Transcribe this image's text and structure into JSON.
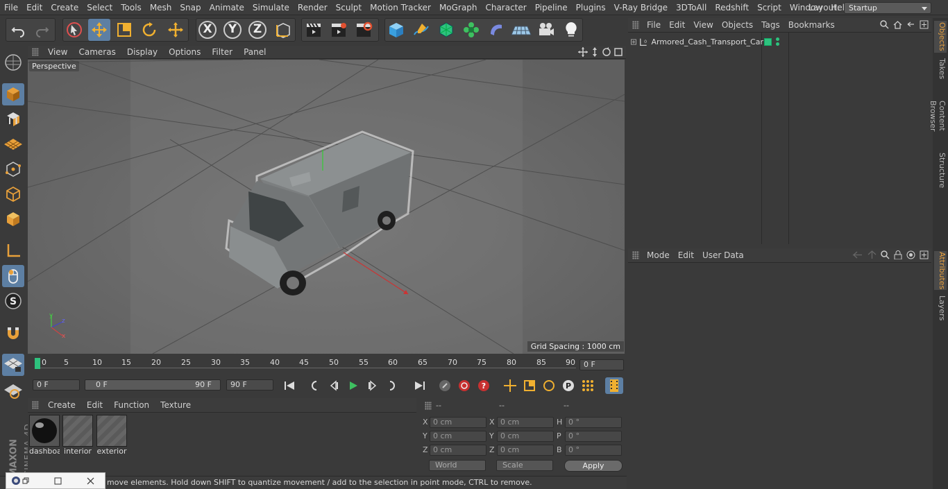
{
  "menubar": {
    "items": [
      "File",
      "Edit",
      "Create",
      "Select",
      "Tools",
      "Mesh",
      "Snap",
      "Animate",
      "Simulate",
      "Render",
      "Sculpt",
      "Motion Tracker",
      "MoGraph",
      "Character",
      "Pipeline",
      "Plugins",
      "V-Ray Bridge",
      "3DToAll",
      "Redshift",
      "Script",
      "Window",
      "Help"
    ],
    "layout_label": "Layout:",
    "layout_value": "Startup"
  },
  "toolbar": {
    "axis_x": "X",
    "axis_y": "Y",
    "axis_z": "Z"
  },
  "viewport": {
    "menu": [
      "View",
      "Cameras",
      "Display",
      "Options",
      "Filter",
      "Panel"
    ],
    "label": "Perspective",
    "grid_spacing": "Grid Spacing : 1000 cm",
    "axis_x": "x",
    "axis_y": "y",
    "axis_z": "z"
  },
  "timeline": {
    "ticks": [
      "0",
      "5",
      "10",
      "15",
      "20",
      "25",
      "30",
      "35",
      "40",
      "45",
      "50",
      "55",
      "60",
      "65",
      "70",
      "75",
      "80",
      "85",
      "90"
    ],
    "current_frame": "0 F"
  },
  "transport": {
    "start_frame": "0 F",
    "range_start": "0 F",
    "range_end": "90 F",
    "end_frame": "90 F"
  },
  "materials": {
    "menu": [
      "Create",
      "Edit",
      "Function",
      "Texture"
    ],
    "items": [
      {
        "name": "dashboa"
      },
      {
        "name": "interior"
      },
      {
        "name": "exterior"
      }
    ]
  },
  "coords": {
    "headers": [
      "--",
      "--",
      "--"
    ],
    "rows": [
      {
        "l1": "X",
        "v1": "0 cm",
        "l2": "X",
        "v2": "0 cm",
        "l3": "H",
        "v3": "0 °"
      },
      {
        "l1": "Y",
        "v1": "0 cm",
        "l2": "Y",
        "v2": "0 cm",
        "l3": "P",
        "v3": "0 °"
      },
      {
        "l1": "Z",
        "v1": "0 cm",
        "l2": "Z",
        "v2": "0 cm",
        "l3": "B",
        "v3": "0 °"
      }
    ],
    "space": "World",
    "mode": "Scale",
    "apply": "Apply"
  },
  "objects": {
    "menu": [
      "File",
      "Edit",
      "View",
      "Objects",
      "Tags",
      "Bookmarks"
    ],
    "items": [
      {
        "name": "Armored_Cash_Transport_Car"
      }
    ]
  },
  "attributes": {
    "menu": [
      "Mode",
      "Edit",
      "User Data"
    ]
  },
  "sidetabs": {
    "top": [
      "Objects",
      "Takes",
      "Content Browser",
      "Structure"
    ],
    "bottom": [
      "Attributes",
      "Layers"
    ]
  },
  "status": {
    "text": "move elements. Hold down SHIFT to quantize movement / add to the selection in point mode, CTRL to remove."
  },
  "brand": {
    "maxon": "MAXON",
    "product": "CINEMA 4D"
  },
  "colors": {
    "accent": "#5d7fa3",
    "tab_active": "#e6a040",
    "object_tag": "#2ec27e"
  }
}
